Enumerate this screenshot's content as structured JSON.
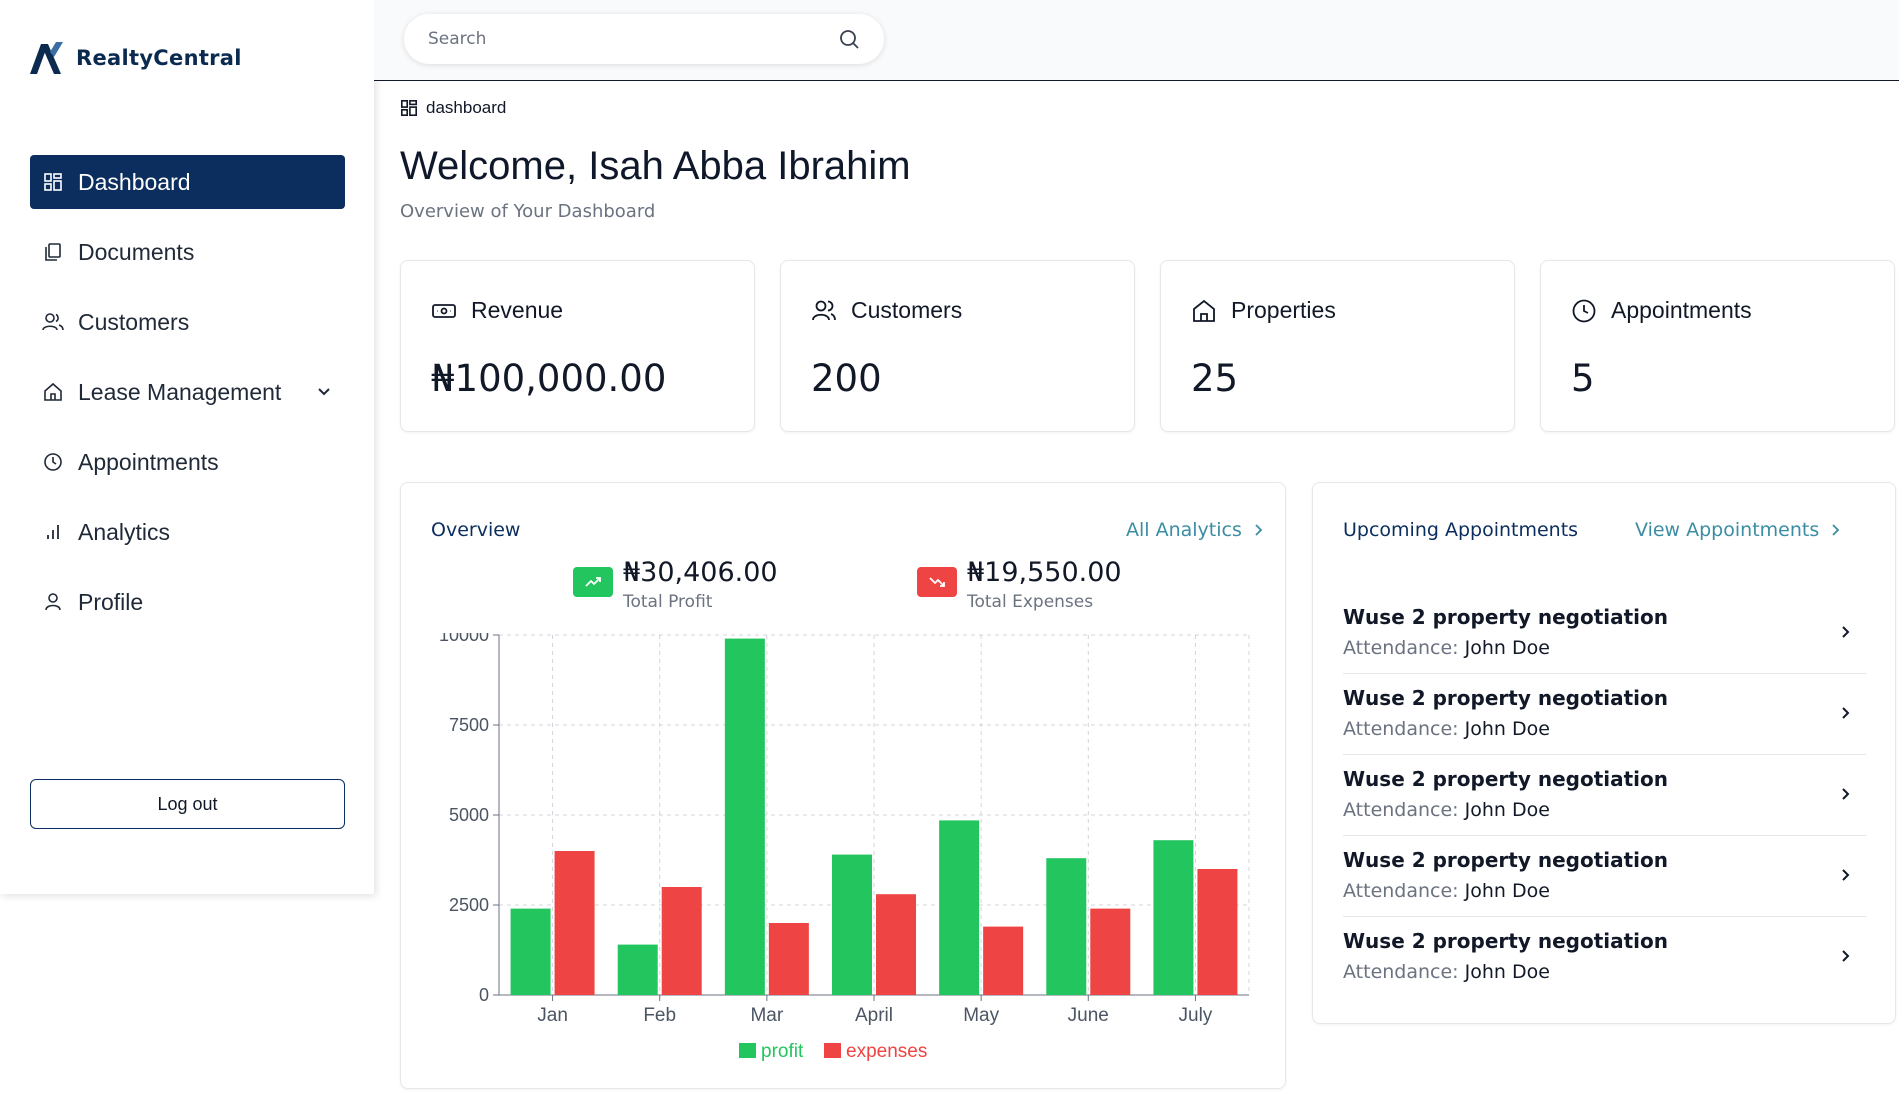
{
  "brand": {
    "name": "RealtyCentral",
    "accent": "#0b2e5e"
  },
  "sidebar": {
    "items": [
      {
        "label": "Dashboard",
        "icon": "grid-icon",
        "active": true
      },
      {
        "label": "Documents",
        "icon": "documents-icon"
      },
      {
        "label": "Customers",
        "icon": "users-icon"
      },
      {
        "label": "Lease Management",
        "icon": "home-icon",
        "has_dropdown": true
      },
      {
        "label": "Appointments",
        "icon": "clock-icon"
      },
      {
        "label": "Analytics",
        "icon": "bar-chart-icon"
      },
      {
        "label": "Profile",
        "icon": "user-icon"
      }
    ],
    "logout_label": "Log out"
  },
  "search": {
    "placeholder": "Search"
  },
  "breadcrumb": {
    "label": "dashboard"
  },
  "page": {
    "title": "Welcome, Isah Abba Ibrahim",
    "subtitle": "Overview of Your Dashboard"
  },
  "stats": [
    {
      "label": "Revenue",
      "value": "₦100,000.00",
      "icon": "banknote-icon"
    },
    {
      "label": "Customers",
      "value": "200",
      "icon": "users-icon"
    },
    {
      "label": "Properties",
      "value": "25",
      "icon": "home-icon"
    },
    {
      "label": "Appointments",
      "value": "5",
      "icon": "clock-icon"
    }
  ],
  "overview": {
    "title": "Overview",
    "link_label": "All Analytics",
    "profit": {
      "amount": "₦30,406.00",
      "label": "Total Profit",
      "color": "#22c55e"
    },
    "expenses": {
      "amount": "₦19,550.00",
      "label": "Total Expenses",
      "color": "#ef4444"
    }
  },
  "chart_data": {
    "type": "bar",
    "categories": [
      "Jan",
      "Feb",
      "Mar",
      "April",
      "May",
      "June",
      "July"
    ],
    "series": [
      {
        "name": "profit",
        "color": "#22c55e",
        "values": [
          2400,
          1400,
          9900,
          3900,
          4850,
          3800,
          4300
        ]
      },
      {
        "name": "expenses",
        "color": "#ef4444",
        "values": [
          4000,
          3000,
          2000,
          2800,
          1900,
          2400,
          3500
        ]
      }
    ],
    "ylim": [
      0,
      10000
    ],
    "yticks": [
      0,
      2500,
      5000,
      7500,
      10000
    ],
    "grid": true,
    "legend": "bottom"
  },
  "appointments": {
    "title": "Upcoming Appointments",
    "link_label": "View Appointments",
    "attendance_label": "Attendance:",
    "items": [
      {
        "title": "Wuse 2 property negotiation",
        "attendee": "John Doe"
      },
      {
        "title": "Wuse 2 property negotiation",
        "attendee": "John Doe"
      },
      {
        "title": "Wuse 2 property negotiation",
        "attendee": "John Doe"
      },
      {
        "title": "Wuse 2 property negotiation",
        "attendee": "John Doe"
      },
      {
        "title": "Wuse 2 property negotiation",
        "attendee": "John Doe"
      }
    ]
  }
}
